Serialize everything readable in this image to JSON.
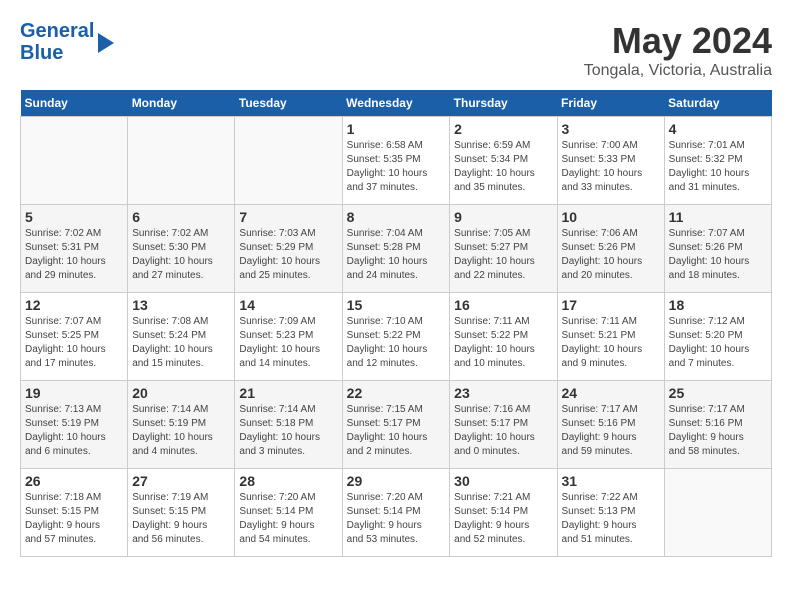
{
  "logo": {
    "line1": "General",
    "line2": "Blue"
  },
  "title": {
    "month_year": "May 2024",
    "location": "Tongala, Victoria, Australia"
  },
  "days_of_week": [
    "Sunday",
    "Monday",
    "Tuesday",
    "Wednesday",
    "Thursday",
    "Friday",
    "Saturday"
  ],
  "weeks": [
    [
      {
        "day": "",
        "info": ""
      },
      {
        "day": "",
        "info": ""
      },
      {
        "day": "",
        "info": ""
      },
      {
        "day": "1",
        "info": "Sunrise: 6:58 AM\nSunset: 5:35 PM\nDaylight: 10 hours\nand 37 minutes."
      },
      {
        "day": "2",
        "info": "Sunrise: 6:59 AM\nSunset: 5:34 PM\nDaylight: 10 hours\nand 35 minutes."
      },
      {
        "day": "3",
        "info": "Sunrise: 7:00 AM\nSunset: 5:33 PM\nDaylight: 10 hours\nand 33 minutes."
      },
      {
        "day": "4",
        "info": "Sunrise: 7:01 AM\nSunset: 5:32 PM\nDaylight: 10 hours\nand 31 minutes."
      }
    ],
    [
      {
        "day": "5",
        "info": "Sunrise: 7:02 AM\nSunset: 5:31 PM\nDaylight: 10 hours\nand 29 minutes."
      },
      {
        "day": "6",
        "info": "Sunrise: 7:02 AM\nSunset: 5:30 PM\nDaylight: 10 hours\nand 27 minutes."
      },
      {
        "day": "7",
        "info": "Sunrise: 7:03 AM\nSunset: 5:29 PM\nDaylight: 10 hours\nand 25 minutes."
      },
      {
        "day": "8",
        "info": "Sunrise: 7:04 AM\nSunset: 5:28 PM\nDaylight: 10 hours\nand 24 minutes."
      },
      {
        "day": "9",
        "info": "Sunrise: 7:05 AM\nSunset: 5:27 PM\nDaylight: 10 hours\nand 22 minutes."
      },
      {
        "day": "10",
        "info": "Sunrise: 7:06 AM\nSunset: 5:26 PM\nDaylight: 10 hours\nand 20 minutes."
      },
      {
        "day": "11",
        "info": "Sunrise: 7:07 AM\nSunset: 5:26 PM\nDaylight: 10 hours\nand 18 minutes."
      }
    ],
    [
      {
        "day": "12",
        "info": "Sunrise: 7:07 AM\nSunset: 5:25 PM\nDaylight: 10 hours\nand 17 minutes."
      },
      {
        "day": "13",
        "info": "Sunrise: 7:08 AM\nSunset: 5:24 PM\nDaylight: 10 hours\nand 15 minutes."
      },
      {
        "day": "14",
        "info": "Sunrise: 7:09 AM\nSunset: 5:23 PM\nDaylight: 10 hours\nand 14 minutes."
      },
      {
        "day": "15",
        "info": "Sunrise: 7:10 AM\nSunset: 5:22 PM\nDaylight: 10 hours\nand 12 minutes."
      },
      {
        "day": "16",
        "info": "Sunrise: 7:11 AM\nSunset: 5:22 PM\nDaylight: 10 hours\nand 10 minutes."
      },
      {
        "day": "17",
        "info": "Sunrise: 7:11 AM\nSunset: 5:21 PM\nDaylight: 10 hours\nand 9 minutes."
      },
      {
        "day": "18",
        "info": "Sunrise: 7:12 AM\nSunset: 5:20 PM\nDaylight: 10 hours\nand 7 minutes."
      }
    ],
    [
      {
        "day": "19",
        "info": "Sunrise: 7:13 AM\nSunset: 5:19 PM\nDaylight: 10 hours\nand 6 minutes."
      },
      {
        "day": "20",
        "info": "Sunrise: 7:14 AM\nSunset: 5:19 PM\nDaylight: 10 hours\nand 4 minutes."
      },
      {
        "day": "21",
        "info": "Sunrise: 7:14 AM\nSunset: 5:18 PM\nDaylight: 10 hours\nand 3 minutes."
      },
      {
        "day": "22",
        "info": "Sunrise: 7:15 AM\nSunset: 5:17 PM\nDaylight: 10 hours\nand 2 minutes."
      },
      {
        "day": "23",
        "info": "Sunrise: 7:16 AM\nSunset: 5:17 PM\nDaylight: 10 hours\nand 0 minutes."
      },
      {
        "day": "24",
        "info": "Sunrise: 7:17 AM\nSunset: 5:16 PM\nDaylight: 9 hours\nand 59 minutes."
      },
      {
        "day": "25",
        "info": "Sunrise: 7:17 AM\nSunset: 5:16 PM\nDaylight: 9 hours\nand 58 minutes."
      }
    ],
    [
      {
        "day": "26",
        "info": "Sunrise: 7:18 AM\nSunset: 5:15 PM\nDaylight: 9 hours\nand 57 minutes."
      },
      {
        "day": "27",
        "info": "Sunrise: 7:19 AM\nSunset: 5:15 PM\nDaylight: 9 hours\nand 56 minutes."
      },
      {
        "day": "28",
        "info": "Sunrise: 7:20 AM\nSunset: 5:14 PM\nDaylight: 9 hours\nand 54 minutes."
      },
      {
        "day": "29",
        "info": "Sunrise: 7:20 AM\nSunset: 5:14 PM\nDaylight: 9 hours\nand 53 minutes."
      },
      {
        "day": "30",
        "info": "Sunrise: 7:21 AM\nSunset: 5:14 PM\nDaylight: 9 hours\nand 52 minutes."
      },
      {
        "day": "31",
        "info": "Sunrise: 7:22 AM\nSunset: 5:13 PM\nDaylight: 9 hours\nand 51 minutes."
      },
      {
        "day": "",
        "info": ""
      }
    ]
  ]
}
